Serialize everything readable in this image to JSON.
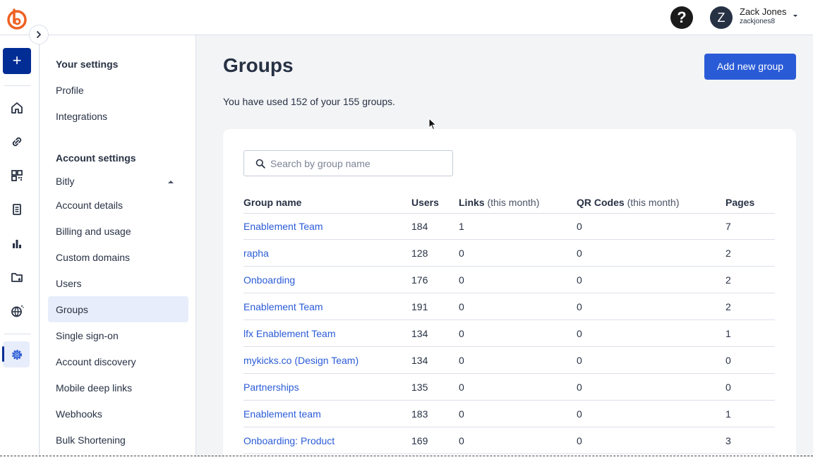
{
  "header": {
    "user_initial": "Z",
    "user_name": "Zack Jones",
    "user_handle": "zackjones8",
    "help_label": "?"
  },
  "rail": {
    "create_label": "+",
    "icons": [
      "home-icon",
      "link-icon",
      "qr-code-icon",
      "pages-icon",
      "analytics-icon",
      "campaigns-icon",
      "custom-domains-icon",
      "settings-icon"
    ]
  },
  "settings_nav": {
    "your_settings_heading": "Your settings",
    "your_settings_items": [
      "Profile",
      "Integrations"
    ],
    "account_settings_heading": "Account settings",
    "account_name": "Bitly",
    "account_items": [
      "Account details",
      "Billing and usage",
      "Custom domains",
      "Users",
      "Groups",
      "Single sign-on",
      "Account discovery",
      "Mobile deep links",
      "Webhooks",
      "Bulk Shortening"
    ],
    "active_item": "Groups"
  },
  "main": {
    "title": "Groups",
    "add_button_label": "Add new group",
    "usage_text": "You have used 152 of your 155 groups.",
    "search_placeholder": "Search by group name"
  },
  "table": {
    "columns": [
      {
        "label": "Group name",
        "sub": ""
      },
      {
        "label": "Users",
        "sub": ""
      },
      {
        "label": "Links",
        "sub": " (this month)"
      },
      {
        "label": "QR Codes",
        "sub": " (this month)"
      },
      {
        "label": "Pages",
        "sub": ""
      }
    ],
    "rows": [
      {
        "name": "Enablement Team",
        "users": "184",
        "links": "1",
        "qr": "0",
        "pages": "7"
      },
      {
        "name": "rapha",
        "users": "128",
        "links": "0",
        "qr": "0",
        "pages": "2"
      },
      {
        "name": "Onboarding",
        "users": "176",
        "links": "0",
        "qr": "0",
        "pages": "2"
      },
      {
        "name": "Enablement Team",
        "users": "191",
        "links": "0",
        "qr": "0",
        "pages": "2"
      },
      {
        "name": "lfx Enablement Team",
        "users": "134",
        "links": "0",
        "qr": "0",
        "pages": "1"
      },
      {
        "name": "mykicks.co (Design Team)",
        "users": "134",
        "links": "0",
        "qr": "0",
        "pages": "0"
      },
      {
        "name": "Partnerships",
        "users": "135",
        "links": "0",
        "qr": "0",
        "pages": "0"
      },
      {
        "name": "Enablement team",
        "users": "183",
        "links": "0",
        "qr": "0",
        "pages": "1"
      },
      {
        "name": "Onboarding: Product",
        "users": "169",
        "links": "0",
        "qr": "0",
        "pages": "3"
      }
    ]
  },
  "colors": {
    "brand": "#ee6123",
    "primary_button": "#2a5bd7",
    "create_button": "#022d94",
    "link": "#2a5bd7",
    "active_nav_bg": "#e8edfb"
  }
}
